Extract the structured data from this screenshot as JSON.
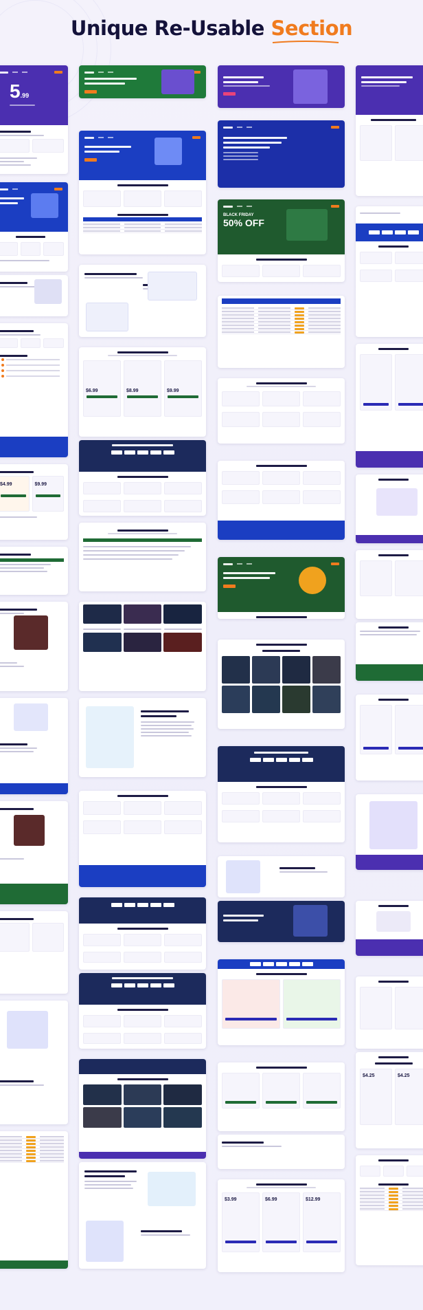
{
  "page": {
    "title_main": "Unique Re-Usable",
    "title_accent": "Section"
  },
  "colors": {
    "accent_orange": "#f07b1e",
    "navy": "#14123a",
    "purple": "#4b2fb0",
    "blue": "#1b3ec2",
    "green": "#1f6b35",
    "dark_navy": "#1c2a5c"
  },
  "previews": {
    "col1": [
      "pricing-hero",
      "pricing-table",
      "vps-hero",
      "features",
      "windows-vps",
      "faq",
      "wordpress",
      "dedicated",
      "cta-support",
      "testimonial",
      "hero-illustration",
      "management",
      "comparison-table"
    ],
    "col2": [
      "green-hero",
      "vps-plans",
      "vps-pricing",
      "speed",
      "flexible-pricing",
      "os-logos",
      "features-grid",
      "faq",
      "game-grid",
      "perfect-env",
      "features",
      "support-cta",
      "os-logos",
      "features",
      "game-server",
      "cloud-hosting",
      "management"
    ],
    "col3": [
      "cloud-hero",
      "purple-hero",
      "black-friday",
      "choose-plan",
      "comparison-table",
      "best-features",
      "best-features",
      "cta-support",
      "green-offer",
      "choose-plan",
      "game-server",
      "os-logos",
      "best-features",
      "platform",
      "cloud-hero",
      "wordpress-plans",
      "flexible-pricing",
      "best-cloud",
      "choose-plan"
    ],
    "col4": [
      "purple-hero",
      "choose-hosting",
      "logos",
      "best-features",
      "pricing",
      "faq",
      "support-cta",
      "web-hosting",
      "pricing",
      "green-faq",
      "choose-plan",
      "illustration",
      "support",
      "support",
      "pricing",
      "perfect-package",
      "server-plans",
      "comparison-table"
    ]
  }
}
